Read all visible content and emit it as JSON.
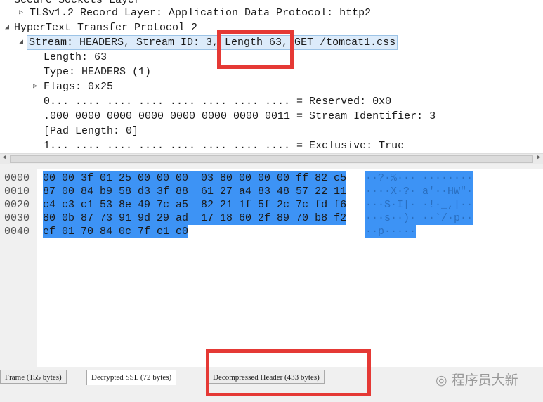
{
  "tree": {
    "rows": [
      "Secure Sockets Layer",
      "TLSv1.2 Record Layer: Application Data Protocol: http2",
      "HyperText Transfer Protocol 2",
      "Stream: HEADERS, Stream ID: 3, Length 63, GET /tomcat1.css",
      "Length: 63",
      "Type: HEADERS (1)",
      "Flags: 0x25",
      "0... .... .... .... .... .... .... .... = Reserved: 0x0",
      ".000 0000 0000 0000 0000 0000 0000 0011 = Stream Identifier: 3",
      "[Pad Length: 0]",
      "1... .... .... .... .... .... .... .... = Exclusive: True"
    ]
  },
  "hex": {
    "offsets": [
      "0000",
      "0010",
      "0020",
      "0030",
      "0040"
    ],
    "bytes": [
      "00 00 3f 01 25 00 00 00  03 80 00 00 00 ff 82 c5",
      "87 00 84 b9 58 d3 3f 88  61 27 a4 83 48 57 22 11",
      "c4 c3 c1 53 8e 49 7c a5  82 21 1f 5f 2c 7c fd f6",
      "80 0b 87 73 91 9d 29 ad  17 18 60 2f 89 70 b8 f2",
      "ef 01 70 84 0c 7f c1 c0"
    ],
    "ascii": [
      "··?·%··· ········",
      "····X·?· a'··HW\"·",
      "···S·I|· ·!·_,|··",
      "···s··)· ··`/·p··",
      "··p·····"
    ],
    "selection_color": "#3d93f5"
  },
  "tabs": [
    {
      "label": "Frame (155 bytes)",
      "active": false
    },
    {
      "label": "Decrypted SSL (72 bytes)",
      "active": true
    },
    {
      "label": "Decompressed Header (433 bytes)",
      "active": false
    }
  ],
  "annotation_color": "#e53935",
  "watermark": "程序员大新"
}
